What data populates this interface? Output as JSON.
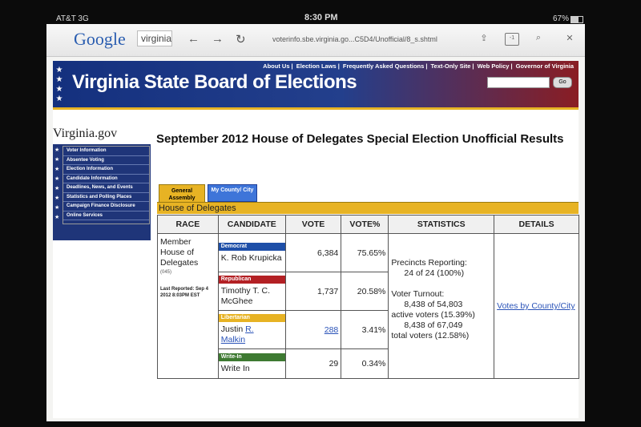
{
  "status_bar": {
    "carrier": "AT&T 3G",
    "time": "8:30 PM",
    "battery": "67%"
  },
  "browser": {
    "logo": "Google",
    "search_text": "virginia",
    "url": "voterinfo.sbe.virginia.go...C5D4/Unofficial/8_s.shtml",
    "icons": [
      "back-arrow-icon",
      "forward-arrow-icon",
      "reload-icon",
      "share-icon",
      "tabs-icon",
      "zoom-search-icon",
      "close-icon"
    ],
    "tabs_label": "-1"
  },
  "site": {
    "banner_title": "Virginia State Board of Elections",
    "top_links": [
      "About Us",
      "Election Laws",
      "Frequently Asked Questions",
      "Text-Only Site",
      "Web Policy",
      "Governor of Virginia"
    ],
    "search_button": "Go",
    "portal": "Virginia.gov",
    "left_nav": [
      "Voter Information",
      "Absentee Voting",
      "Election Information",
      "Candidate Information",
      "Deadlines, News, and Events",
      "Statistics and Polling Places",
      "Campaign Finance Disclosure",
      "Online Services"
    ]
  },
  "page": {
    "title": "September 2012 House of Delegates Special Election Unofficial Results",
    "tabs": [
      "General Assembly",
      "My County/ City"
    ],
    "section": "House of Delegates"
  },
  "table": {
    "headers": [
      "RACE",
      "CANDIDATE",
      "VOTE",
      "VOTE%",
      "STATISTICS",
      "DETAILS"
    ],
    "race": {
      "name": "Member House of Delegates",
      "code": "(045)",
      "last_reported": "Last Reported: Sep 4 2012 8:03PM EST"
    },
    "rows": [
      {
        "party": "Democrat",
        "candidate": "K. Rob Krupicka",
        "votes": "6,384",
        "pct": "75.65%"
      },
      {
        "party": "Republican",
        "candidate": "Timothy T. C. McGhee",
        "votes": "1,737",
        "pct": "20.58%"
      },
      {
        "party": "Libertarian",
        "candidate_first": "Justin",
        "candidate_link1": "R.",
        "candidate_link2": "Malkin",
        "votes": "288",
        "pct": "3.41%"
      },
      {
        "party": "Write-In",
        "candidate": "Write In",
        "votes": "29",
        "pct": "0.34%"
      }
    ],
    "stats": {
      "precincts_label": "Precincts Reporting:",
      "precincts_value": "24 of 24 (100%)",
      "turnout_label": "Voter Turnout:",
      "turnout_active_1": "8,438 of 54,803",
      "turnout_active_2": "active voters (15.39%)",
      "turnout_total_1": "8,438 of 67,049",
      "turnout_total_2": "total voters (12.58%)"
    },
    "details_link": "Votes by County/City"
  }
}
